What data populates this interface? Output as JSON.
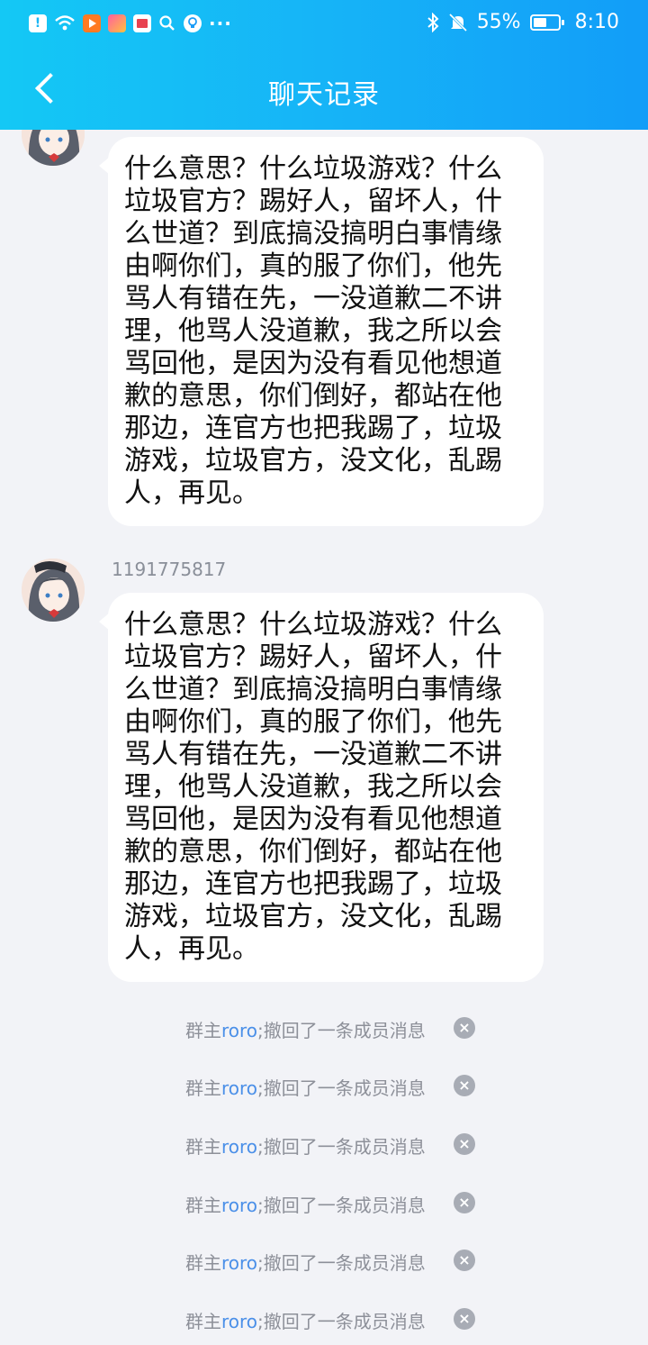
{
  "status_bar": {
    "battery": "55%",
    "battery_level": 0.55,
    "time": "8:10",
    "icons": [
      "alert-icon",
      "wifi-icon",
      "video-app-icon",
      "app-icon",
      "book-app-icon",
      "search-icon",
      "bulb-icon",
      "more-icon",
      "bluetooth-icon",
      "mute-icon",
      "battery-icon"
    ]
  },
  "nav": {
    "title": "聊天记录"
  },
  "messages": [
    {
      "sender": "",
      "text": "什么意思？什么垃圾游戏？什么垃圾官方？踢好人，留坏人，什么世道？到底搞没搞明白事情缘由啊你们，真的服了你们，他先骂人有错在先，一没道歉二不讲理，他骂人没道歉，我之所以会骂回他，是因为没有看见他想道歉的意思，你们倒好，都站在他那边，连官方也把我踢了，垃圾游戏，垃圾官方，没文化，乱踢人，再见。"
    },
    {
      "sender": "1191775817",
      "text": "什么意思？什么垃圾游戏？什么垃圾官方？踢好人，留坏人，什么世道？到底搞没搞明白事情缘由啊你们，真的服了你们，他先骂人有错在先，一没道歉二不讲理，他骂人没道歉，我之所以会骂回他，是因为没有看见他想道歉的意思，你们倒好，都站在他那边，连官方也把我踢了，垃圾游戏，垃圾官方，没文化，乱踢人，再见。"
    }
  ],
  "system_notices": [
    {
      "prefix": "群主",
      "name": "roro",
      "suffix": ";撤回了一条成员消息",
      "close": "×"
    },
    {
      "prefix": "群主",
      "name": "roro",
      "suffix": ";撤回了一条成员消息",
      "close": "×"
    },
    {
      "prefix": "群主",
      "name": "roro",
      "suffix": ";撤回了一条成员消息",
      "close": "×"
    },
    {
      "prefix": "群主",
      "name": "roro",
      "suffix": ";撤回了一条成员消息",
      "close": "×"
    },
    {
      "prefix": "群主",
      "name": "roro",
      "suffix": ";撤回了一条成员消息",
      "close": "×"
    },
    {
      "prefix": "群主",
      "name": "roro",
      "suffix": ";撤回了一条成员消息",
      "close": "×"
    }
  ],
  "colors": {
    "header_start": "#14c8f5",
    "header_end": "#129df8",
    "background": "#f2f3f7",
    "link": "#4a8fe8"
  }
}
